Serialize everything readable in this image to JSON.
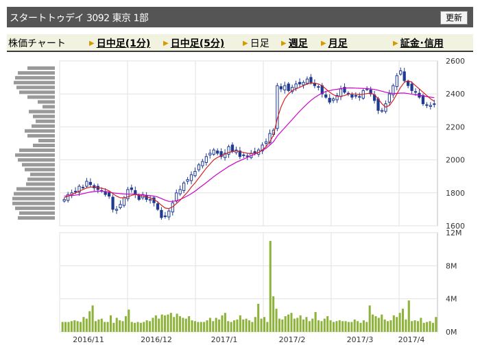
{
  "header": {
    "title": "スタートトゥデイ 3092 東京 1部",
    "refresh_label": "更新"
  },
  "tabs": [
    {
      "label": "株価チャート",
      "link": false,
      "arrow": false
    },
    {
      "label": "日中足(1分)",
      "link": true,
      "arrow": true
    },
    {
      "label": "日中足(5分)",
      "link": true,
      "arrow": true
    },
    {
      "label": "日足",
      "link": false,
      "arrow": true
    },
    {
      "label": "週足",
      "link": true,
      "arrow": true
    },
    {
      "label": "月足",
      "link": true,
      "arrow": true
    },
    {
      "label": "証金･信用",
      "link": true,
      "arrow": true
    }
  ],
  "colors": {
    "up": "#ffffff",
    "down": "#1f3a93",
    "ma_short": "#d42020",
    "ma_long": "#cc00cc",
    "volume": "#8db33a",
    "profile": "#999999"
  },
  "chart_data": [
    {
      "type": "candlestick",
      "y_ticks": [
        "2600",
        "2400",
        "2200",
        "2000",
        "1800",
        "1600"
      ],
      "ylim": [
        1600,
        2600
      ],
      "x_ticks": [
        "2016/11",
        "2016/12",
        "2017/1",
        "2017/2",
        "2017/3",
        "2017/4"
      ],
      "grid": true,
      "close": [
        1760,
        1790,
        1800,
        1810,
        1840,
        1830,
        1870,
        1850,
        1830,
        1820,
        1810,
        1790,
        1780,
        1700,
        1700,
        1730,
        1770,
        1820,
        1820,
        1790,
        1760,
        1790,
        1760,
        1760,
        1740,
        1700,
        1650,
        1660,
        1690,
        1740,
        1800,
        1820,
        1860,
        1880,
        1910,
        1930,
        1970,
        1990,
        2020,
        2040,
        2060,
        2040,
        2020,
        2040,
        2080,
        2050,
        2060,
        2020,
        2030,
        2020,
        2040,
        2040,
        2060,
        2090,
        2110,
        2160,
        2180,
        2450,
        2430,
        2450,
        2420,
        2440,
        2460,
        2460,
        2470,
        2490,
        2470,
        2450,
        2440,
        2400,
        2380,
        2350,
        2370,
        2390,
        2430,
        2410,
        2400,
        2380,
        2390,
        2380,
        2420,
        2430,
        2400,
        2360,
        2300,
        2300,
        2340,
        2400,
        2450,
        2510,
        2540,
        2480,
        2450,
        2420,
        2410,
        2380,
        2340,
        2330,
        2330,
        2340
      ],
      "ma_short": [
        1770,
        1780,
        1790,
        1800,
        1810,
        1820,
        1830,
        1835,
        1835,
        1832,
        1828,
        1822,
        1812,
        1795,
        1780,
        1770,
        1770,
        1775,
        1785,
        1790,
        1785,
        1780,
        1775,
        1770,
        1760,
        1745,
        1725,
        1708,
        1705,
        1715,
        1735,
        1755,
        1780,
        1805,
        1835,
        1860,
        1890,
        1920,
        1950,
        1975,
        2000,
        2015,
        2025,
        2035,
        2045,
        2050,
        2055,
        2050,
        2045,
        2040,
        2038,
        2040,
        2045,
        2060,
        2080,
        2110,
        2150,
        2250,
        2320,
        2370,
        2400,
        2420,
        2430,
        2440,
        2450,
        2460,
        2465,
        2465,
        2460,
        2450,
        2430,
        2410,
        2395,
        2385,
        2385,
        2390,
        2398,
        2400,
        2398,
        2395,
        2398,
        2402,
        2405,
        2395,
        2370,
        2340,
        2320,
        2330,
        2360,
        2400,
        2440,
        2470,
        2480,
        2470,
        2450,
        2430,
        2410,
        2390,
        2370,
        2355
      ],
      "ma_long": [
        1780,
        1782,
        1784,
        1786,
        1790,
        1795,
        1800,
        1805,
        1808,
        1810,
        1810,
        1808,
        1805,
        1800,
        1797,
        1795,
        1793,
        1792,
        1792,
        1792,
        1790,
        1788,
        1785,
        1783,
        1780,
        1775,
        1765,
        1755,
        1748,
        1748,
        1752,
        1760,
        1770,
        1782,
        1795,
        1810,
        1828,
        1845,
        1862,
        1880,
        1898,
        1915,
        1930,
        1945,
        1960,
        1972,
        1985,
        1995,
        2005,
        2015,
        2025,
        2035,
        2045,
        2058,
        2070,
        2090,
        2110,
        2145,
        2170,
        2195,
        2220,
        2245,
        2270,
        2295,
        2318,
        2340,
        2360,
        2378,
        2392,
        2405,
        2415,
        2420,
        2425,
        2428,
        2432,
        2435,
        2436,
        2436,
        2435,
        2434,
        2433,
        2432,
        2430,
        2427,
        2422,
        2416,
        2410,
        2405,
        2403,
        2403,
        2405,
        2405,
        2402,
        2398,
        2395,
        2392,
        2388,
        2384,
        2380,
        2377
      ]
    },
    {
      "type": "bar",
      "y_ticks": [
        "12M",
        "8M",
        "4M",
        "0M"
      ],
      "ylim": [
        0,
        12
      ],
      "values": [
        1.2,
        1.2,
        1.2,
        1.3,
        1.4,
        1.3,
        1.2,
        1.8,
        1.6,
        2.5,
        3.2,
        1.3,
        1.5,
        1.6,
        1.2,
        1.2,
        2.0,
        1.1,
        1.7,
        1.4,
        1.3,
        1.9,
        2.7,
        1.2,
        1.1,
        1.2,
        1.1,
        1.2,
        1.4,
        1.3,
        1.7,
        2.0,
        1.6,
        2.1,
        2.0,
        2.1,
        2.3,
        1.8,
        2.2,
        1.9,
        1.7,
        1.6,
        1.9,
        1.4,
        1.3,
        1.2,
        1.2,
        1.2,
        1.4,
        1.7,
        1.3,
        1.7,
        1.5,
        2.0,
        2.3,
        1.3,
        1.2,
        1.4,
        1.5,
        2.0,
        1.5,
        1.6,
        1.4,
        1.2,
        1.8,
        3.4,
        1.6,
        1.8,
        1.2,
        11.0,
        4.3,
        2.8,
        1.6,
        1.5,
        1.9,
        2.1,
        2.3,
        1.6,
        1.7,
        2.0,
        1.5,
        1.8,
        1.3,
        1.6,
        2.4,
        1.4,
        1.3,
        1.6,
        1.9,
        1.4,
        1.2,
        1.3,
        1.4,
        1.3,
        1.3,
        1.2,
        1.2,
        1.5,
        1.3,
        1.1,
        1.4,
        1.2,
        3.2,
        2.1,
        1.9,
        1.7,
        2.1,
        1.5,
        1.3,
        1.4,
        2.0,
        1.8,
        2.3,
        2.8,
        1.5,
        3.8,
        1.3,
        1.4,
        1.3,
        1.7,
        1.1,
        1.2,
        1.3,
        1.1,
        1.8
      ]
    }
  ]
}
